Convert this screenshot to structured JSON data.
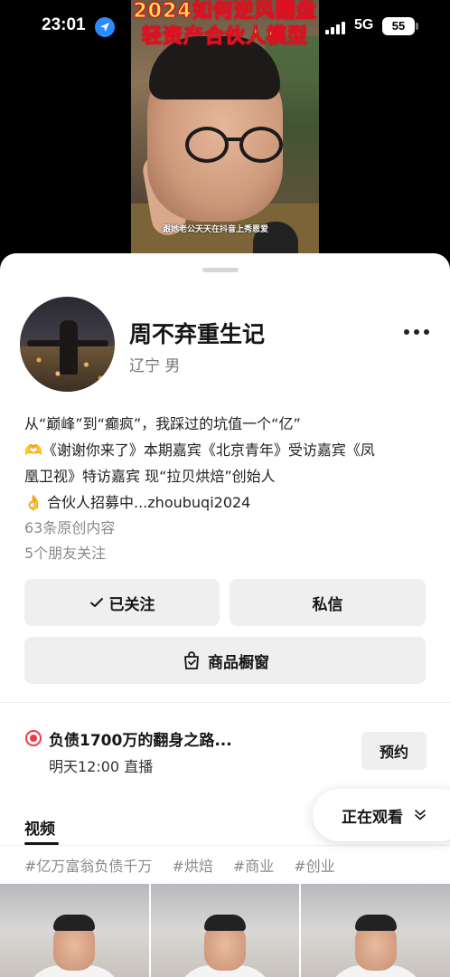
{
  "status_bar": {
    "time": "23:01",
    "network": "5G",
    "battery": "55"
  },
  "video": {
    "headline_line1": "2024如何逆风翻盘",
    "headline_line2": "轻资产合伙人模型",
    "subtitle": "跟她老公天天在抖音上秀恩爱"
  },
  "profile": {
    "name": "周不弃重生记",
    "region": "辽宁  男",
    "bio": [
      "从“巅峰”到“癫疯”，我踩过的坑值一个“亿”",
      "《谢谢你来了》本期嘉宾《北京青年》受访嘉宾《凤",
      "凰卫视》特访嘉宾 现“拉贝烘焙”创始人",
      "合伙人招募中...zhoubuqi2024"
    ],
    "bio_emojis": [
      "🫶",
      "👌"
    ],
    "original_count": "63条原创内容",
    "friends_following": "5个朋友关注"
  },
  "actions": {
    "follow_label": "已关注",
    "message_label": "私信",
    "shop_label": "商品橱窗"
  },
  "live": {
    "title": "负债1700万的翻身之路...",
    "time": "明天12:00 直播",
    "reserve_label": "预约"
  },
  "watching_label": "正在观看",
  "tabs": {
    "video_label": "视频"
  },
  "tags": [
    "#亿万富翁负债千万",
    "#烘焙",
    "#商业",
    "#创业"
  ],
  "colors": {
    "accent_red": "#ef3a4a",
    "location_blue": "#2b8cff",
    "button_bg": "#efefef"
  },
  "icons": [
    "location-arrow-icon",
    "signal-icon",
    "battery-icon",
    "more-icon",
    "check-icon",
    "shop-bag-icon",
    "live-dot-icon",
    "chevron-double-down-icon"
  ]
}
